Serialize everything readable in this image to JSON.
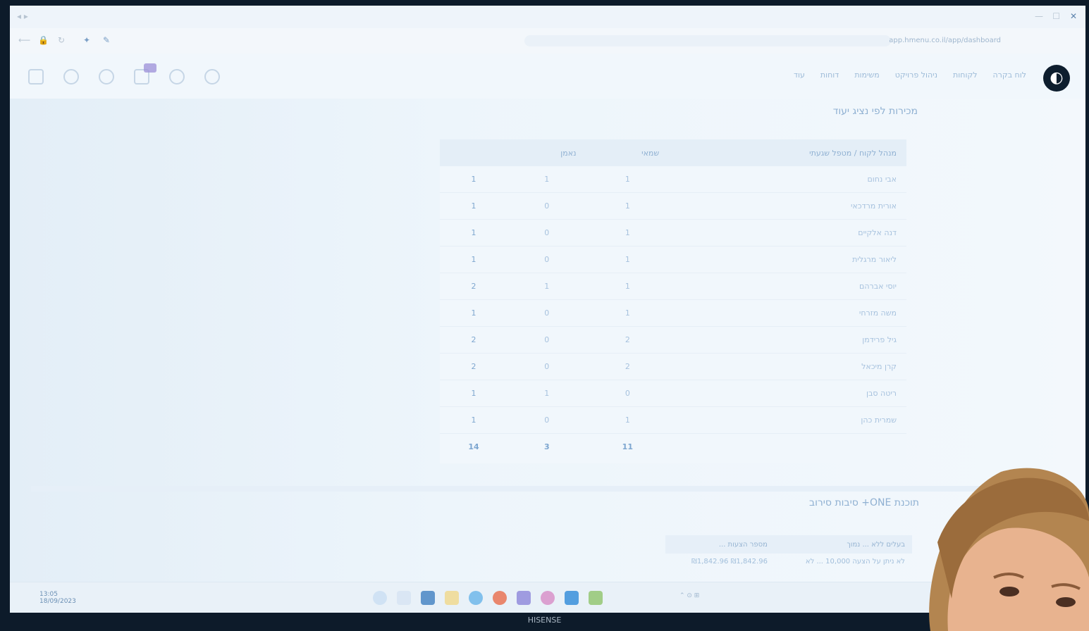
{
  "browser": {
    "url": "app.hmenu.co.il/app/dashboard"
  },
  "app": {
    "nav": [
      "לוח בקרה",
      "לקוחות",
      "ניהול פרויקט",
      "משימות",
      "דוחות",
      "עוד"
    ]
  },
  "section1": {
    "title": "מכירות לפי נציג יעוד",
    "table": {
      "headers": [
        "מנהל לקוח / מטפל שגעתי",
        "שמאי",
        "נאמן",
        ""
      ],
      "rows": [
        {
          "name": "אבי נחום",
          "a": "1",
          "b": "1",
          "total": "1"
        },
        {
          "name": "אורית מרדכאי",
          "a": "1",
          "b": "0",
          "total": "1"
        },
        {
          "name": "דנה אלקיים",
          "a": "1",
          "b": "0",
          "total": "1"
        },
        {
          "name": "ליאור מרגלית",
          "a": "1",
          "b": "0",
          "total": "1"
        },
        {
          "name": "יוסי אברהם",
          "a": "1",
          "b": "1",
          "total": "2"
        },
        {
          "name": "משה מזרחי",
          "a": "1",
          "b": "0",
          "total": "1"
        },
        {
          "name": "גיל פרידמן",
          "a": "2",
          "b": "0",
          "total": "2"
        },
        {
          "name": "קרן מיכאל",
          "a": "2",
          "b": "0",
          "total": "2"
        },
        {
          "name": "ריטה סבן",
          "a": "0",
          "b": "1",
          "total": "1"
        },
        {
          "name": "שמרית כהן",
          "a": "1",
          "b": "0",
          "total": "1"
        }
      ],
      "totals": {
        "a": "11",
        "b": "3",
        "total": "14"
      }
    }
  },
  "section2": {
    "title": "תוכנת ONE+ סיבות סירוב",
    "headers": [
      "בעלים ללא ... נמוך",
      "מספר הצעות ..."
    ],
    "row": [
      "לא ניתן על הצעה 10,000 ... לא",
      "₪1,842.96 ₪1,842.96"
    ]
  },
  "taskbar": {
    "time": "13:05",
    "date": "18/09/2023"
  },
  "monitor": {
    "brand": "HISENSE"
  },
  "colors": {
    "accent": "#7da6d0",
    "screen_bg": "#edf5fb",
    "chat_badge": "#9b8fd8"
  }
}
